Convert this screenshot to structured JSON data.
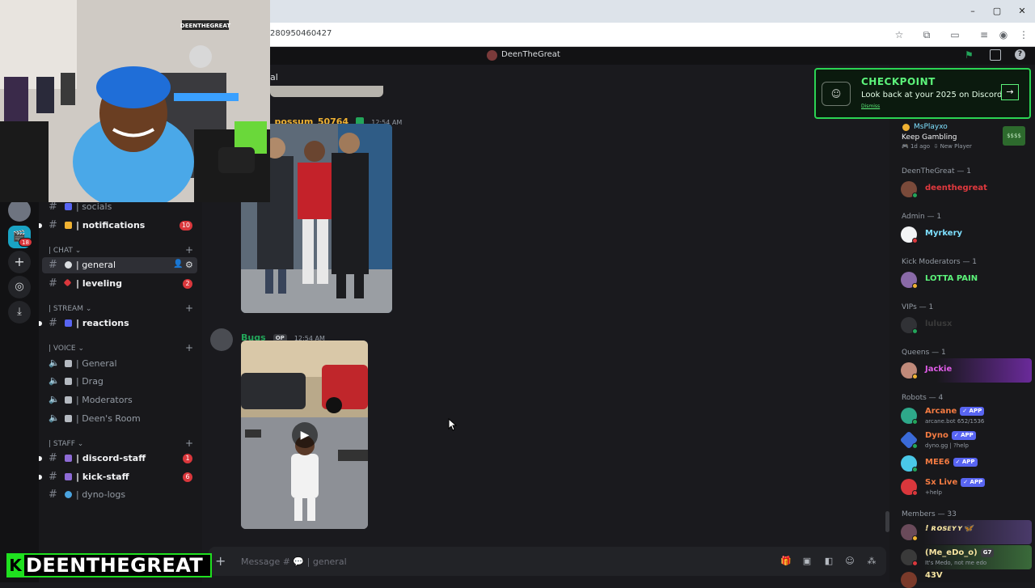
{
  "browser": {
    "url_fragment": "280950460427",
    "window_buttons": [
      "–",
      "▢",
      "✕"
    ]
  },
  "titlebar": {
    "server_name": "DeenTheGreat"
  },
  "main_header": {
    "channel_fragment": "al"
  },
  "channels": {
    "top_items": [
      {
        "name": "| socials"
      },
      {
        "name": "| notifications",
        "badge": "10"
      }
    ],
    "categories": [
      {
        "label": "| CHAT",
        "channels": [
          {
            "name": "| general"
          },
          {
            "name": "| leveling",
            "badge": "2"
          }
        ]
      },
      {
        "label": "| STREAM",
        "channels": [
          {
            "name": "| reactions"
          }
        ]
      },
      {
        "label": "| VOICE",
        "channels": [
          {
            "name": "| General"
          },
          {
            "name": "| Drag"
          },
          {
            "name": "| Moderators"
          },
          {
            "name": "| Deen's Room"
          }
        ]
      },
      {
        "label": "| STAFF",
        "channels": [
          {
            "name": "| discord-staff",
            "badge": "1"
          },
          {
            "name": "| kick-staff",
            "badge": "6"
          },
          {
            "name": "| dyno-logs"
          }
        ]
      }
    ]
  },
  "rail": {
    "mention_badge": "18"
  },
  "messages": [
    {
      "author": "_possum_50764",
      "time": "12:54 AM"
    },
    {
      "author": "Bugs",
      "tag": "OP",
      "time": "12:54 AM"
    }
  ],
  "composer": {
    "placeholder": "Message # 💬 | general"
  },
  "checkpoint": {
    "title": "CHECKPOINT",
    "subtitle": "Look back at your 2025 on Discord",
    "dismiss": "Dismiss"
  },
  "activity": {
    "name": "MsPlayxo",
    "status": "Keep Gambling",
    "meta_time": "1d ago",
    "meta_tag": "New Player"
  },
  "member_groups": [
    {
      "label": "DeenTheGreat — 1",
      "members": [
        {
          "name": "deenthegreat",
          "color": "#e0393e"
        }
      ]
    },
    {
      "label": "Admin — 1",
      "members": [
        {
          "name": "Myrkery",
          "color": "#7ee0ff"
        }
      ]
    },
    {
      "label": "Kick Moderators — 1",
      "members": [
        {
          "name": "LOTTA PAIN",
          "color": "#5cf27a"
        }
      ]
    },
    {
      "label": "VIPs — 1",
      "members": [
        {
          "name": "lulusx",
          "color": "#3a3a3a"
        }
      ]
    },
    {
      "label": "Queens — 1",
      "members": [
        {
          "name": "Jackie",
          "color": "#e05ce8"
        }
      ]
    },
    {
      "label": "Robots — 4",
      "members": [
        {
          "name": "Arcane",
          "color": "#f47b42",
          "app": "✓ APP",
          "sub": "arcane.bot 652/1536"
        },
        {
          "name": "Dyno",
          "color": "#f47b42",
          "app": "✓ APP",
          "sub": "dyno.gg | ?help"
        },
        {
          "name": "MEE6",
          "color": "#f47b42",
          "app": "✓ APP"
        },
        {
          "name": "Sx Live",
          "color": "#f47b42",
          "app": "✓ APP",
          "sub": "+help"
        }
      ]
    },
    {
      "label": "Members — 33",
      "members": [
        {
          "name": "! ʀᴏꜱᴇʏʏ🦋",
          "color": "#f5e3a0"
        },
        {
          "name": "(Me_eDo_o)",
          "color": "#f5e3a0",
          "tag": "G7",
          "sub": "It's Medo, not me edo"
        },
        {
          "name": "43V",
          "color": "#f5e3a0"
        }
      ]
    }
  ],
  "overlay": {
    "streamer_k": "K",
    "streamer_name": "DEENTHEGREAT",
    "webcam_banner": "DEENTHEGREAT"
  },
  "colors": {
    "accent_green": "#2bd453",
    "badge_red": "#da373c",
    "app_blue": "#5865f2"
  }
}
